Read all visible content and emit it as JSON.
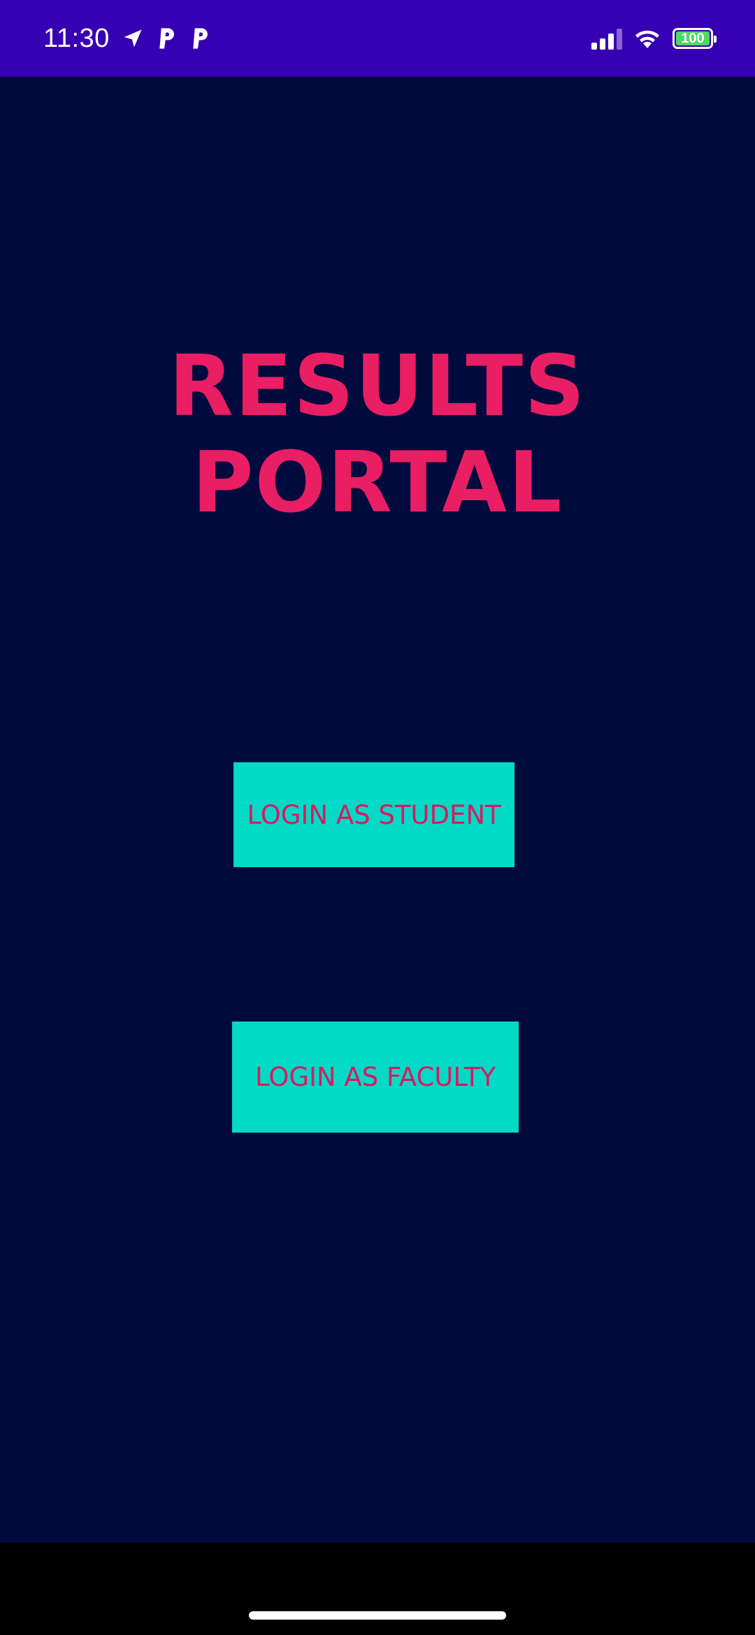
{
  "status_bar": {
    "time": "11:30",
    "battery_level": "100",
    "icons": [
      "location-arrow-icon",
      "parking-icon",
      "parking-icon",
      "signal-icon",
      "wifi-icon",
      "battery-icon"
    ],
    "background_color": "#3700b3"
  },
  "main": {
    "title_line1": "RESULTS",
    "title_line2": "PORTAL",
    "title_color": "#e91e63",
    "background_color": "#000a3d",
    "buttons": [
      {
        "label": "LOGIN AS STUDENT",
        "background": "#00dac6",
        "text_color": "#d81b60"
      },
      {
        "label": "LOGIN AS FACULTY",
        "background": "#00dac6",
        "text_color": "#d81b60"
      }
    ]
  }
}
